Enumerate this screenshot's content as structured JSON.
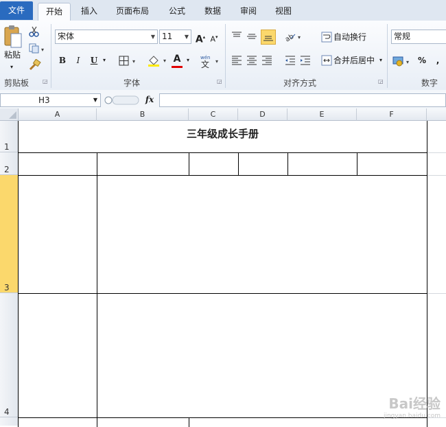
{
  "tabs": {
    "file": "文件",
    "home": "开始",
    "insert": "插入",
    "page_layout": "页面布局",
    "formulas": "公式",
    "data": "数据",
    "review": "审阅",
    "view": "视图"
  },
  "ribbon": {
    "clipboard": {
      "label": "剪贴板",
      "paste": "粘贴"
    },
    "font": {
      "label": "字体",
      "font_name": "宋体",
      "font_size": "11",
      "bold": "B",
      "italic": "I",
      "underline": "U",
      "font_color_glyph": "A"
    },
    "alignment": {
      "label": "对齐方式",
      "wrap_text": "自动换行",
      "merge_center": "合并后居中"
    },
    "number": {
      "label": "数字",
      "format": "常规",
      "percent": "%",
      "comma": ","
    }
  },
  "formula_bar": {
    "name_box": "H3",
    "fx": "fx",
    "formula": ""
  },
  "columns": [
    "A",
    "B",
    "C",
    "D",
    "E",
    "F"
  ],
  "rows": [
    "1",
    "2",
    "3",
    "4"
  ],
  "sheet": {
    "title": "三年级成长手册"
  },
  "watermark": {
    "main": "Bai经验",
    "sub": "jingyan.baidu.com"
  },
  "colors": {
    "tab_file": "#2a6bbf",
    "selection": "#fbd86c",
    "ribbon_bg": "#e8eef6"
  }
}
